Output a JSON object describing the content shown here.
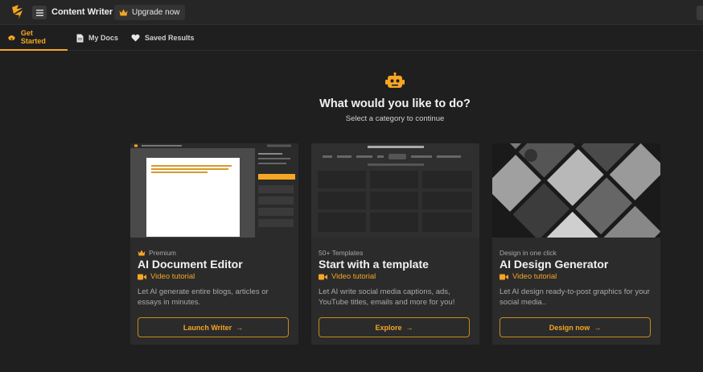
{
  "header": {
    "app_title": "Content Writer",
    "upgrade_label": "Upgrade now"
  },
  "tabs": [
    {
      "label": "Get Started",
      "icon": "rocket-icon",
      "active": true
    },
    {
      "label": "My Docs",
      "icon": "document-icon",
      "active": false
    },
    {
      "label": "Saved Results",
      "icon": "heart-icon",
      "active": false
    }
  ],
  "hero": {
    "icon": "robot-icon",
    "title": "What would you like to do?",
    "subtitle": "Select a category to continue"
  },
  "cards": [
    {
      "eyebrow": "Premium",
      "title": "AI Document Editor",
      "video_label": "Video tutorial",
      "description": "Let AI generate entire blogs, articles or essays in minutes.",
      "button_label": "Launch Writer"
    },
    {
      "eyebrow": "50+ Templates",
      "title": "Start with a template",
      "video_label": "Video tutorial",
      "description": "Let AI write social media captions, ads, YouTube titles, emails and more for you!",
      "button_label": "Explore"
    },
    {
      "eyebrow": "Design in one click",
      "title": "AI Design Generator",
      "video_label": "Video tutorial",
      "description": "Let AI design ready-to-post graphics for your social media..",
      "button_label": "Design now"
    }
  ],
  "colors": {
    "accent": "#f5a623",
    "background": "#1f1f1f",
    "card": "#2b2b2b",
    "topbar": "#262626"
  }
}
